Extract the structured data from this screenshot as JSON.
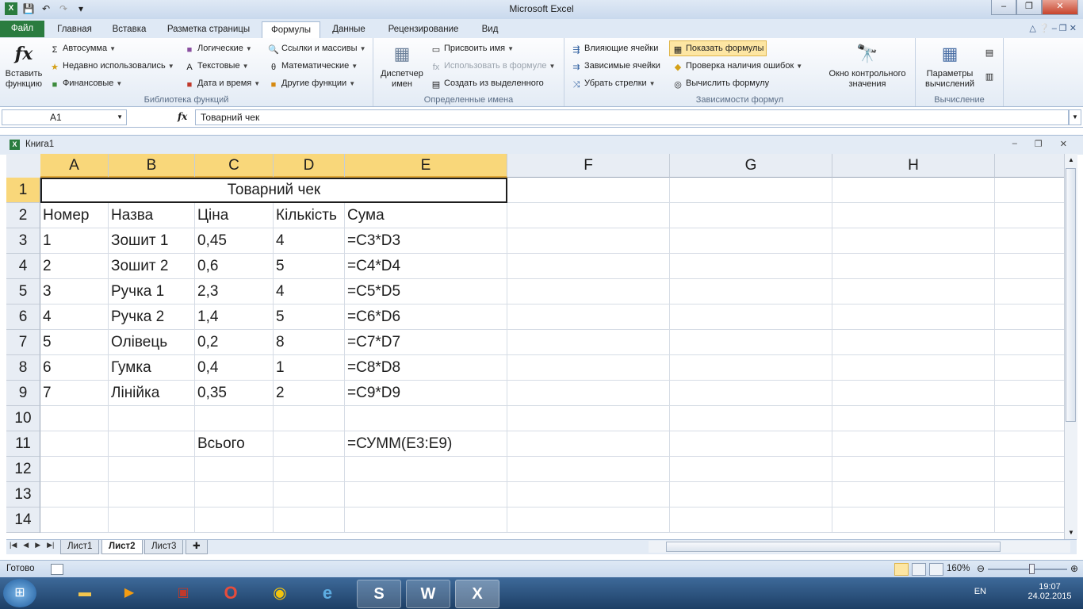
{
  "window": {
    "title": "Microsoft Excel"
  },
  "qat": {
    "save": "💾",
    "undo": "↶",
    "redo": "↷",
    "more": "▾"
  },
  "ribbon_tabs": [
    "Файл",
    "Главная",
    "Вставка",
    "Разметка страницы",
    "Формулы",
    "Данные",
    "Рецензирование",
    "Вид"
  ],
  "active_tab": "Формулы",
  "ribbon": {
    "insert_function": "Вставить функцию",
    "library": {
      "label": "Библиотека функций",
      "autosum": "Автосумма",
      "recent": "Недавно использовались",
      "financial": "Финансовые",
      "logical": "Логические",
      "text": "Текстовые",
      "datetime": "Дата и время",
      "lookup": "Ссылки и массивы",
      "math": "Математические",
      "other": "Другие функции"
    },
    "names": {
      "label": "Определенные имена",
      "manager": "Диспетчер имен",
      "define": "Присвоить имя",
      "use": "Использовать в формуле",
      "create": "Создать из выделенного"
    },
    "audit": {
      "label": "Зависимости формул",
      "precedents": "Влияющие ячейки",
      "dependents": "Зависимые ячейки",
      "remove_arrows": "Убрать стрелки",
      "show_formulas": "Показать формулы",
      "error_check": "Проверка наличия ошибок",
      "evaluate": "Вычислить формулу",
      "watch": "Окно контрольного значения"
    },
    "calc": {
      "label": "Вычисление",
      "options": "Параметры вычислений"
    }
  },
  "formula_bar": {
    "name_box": "A1",
    "fx": "fx",
    "content": "Товарний чек"
  },
  "workbook": {
    "title": "Книга1"
  },
  "sheet": {
    "columns": [
      "A",
      "B",
      "C",
      "D",
      "E",
      "F",
      "G",
      "H"
    ],
    "rows": [
      "1",
      "2",
      "3",
      "4",
      "5",
      "6",
      "7",
      "8",
      "9",
      "10",
      "11",
      "12",
      "13",
      "14"
    ],
    "merged_title": "Товарний чек",
    "data": [
      [
        "Номер",
        "Назва",
        "Ціна",
        "Кількість",
        "Сума"
      ],
      [
        "1",
        "Зошит 1",
        "0,45",
        "4",
        "=C3*D3"
      ],
      [
        "2",
        "Зошит 2",
        "0,6",
        "5",
        "=C4*D4"
      ],
      [
        "3",
        "Ручка 1",
        "2,3",
        "4",
        "=C5*D5"
      ],
      [
        "4",
        "Ручка 2",
        "1,4",
        "5",
        "=C6*D6"
      ],
      [
        "5",
        "Олівець",
        "0,2",
        "8",
        "=C7*D7"
      ],
      [
        "6",
        "Гумка",
        "0,4",
        "1",
        "=C8*D8"
      ],
      [
        "7",
        "Лінійка",
        "0,35",
        "2",
        "=C9*D9"
      ],
      [
        "",
        "",
        "",
        "",
        ""
      ],
      [
        "",
        "",
        "Всього",
        "",
        "=СУММ(E3:E9)"
      ]
    ]
  },
  "sheet_tabs": [
    "Лист1",
    "Лист2",
    "Лист3"
  ],
  "active_sheet": "Лист2",
  "status": {
    "ready": "Готово",
    "zoom": "160%",
    "zoom_fraction": 0.55
  },
  "taskbar": {
    "lang": "EN",
    "time": "19:07",
    "date": "24.02.2015",
    "apps": [
      "explorer-icon",
      "media-player-icon",
      "floppy-icon",
      "opera-icon",
      "chrome-icon",
      "ie-icon",
      "skype-icon",
      "word-icon",
      "excel-icon"
    ]
  },
  "colors": {
    "accent": "#2a7c3f",
    "selection": "#f9d77a",
    "highlight": "#fde6a3"
  }
}
